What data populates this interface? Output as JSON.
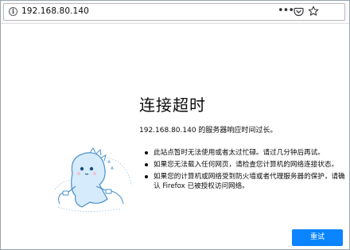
{
  "toolbar": {
    "url": "192.168.80.140",
    "icons": [
      "info-icon",
      "page-actions-menu-icon",
      "pocket-icon",
      "bookmark-star-icon"
    ],
    "menu_glyph": "•••"
  },
  "error_page": {
    "title": "连接超时",
    "description": "192.168.80.140 的服务器响应时间过长。",
    "suggestions": [
      "此站点暂时无法使用或者太过忙碌。请过几分钟后再试。",
      "如果您无法载入任何网页，请检查您计算机的网络连接状态。",
      "如果您的计算机或网络受到防火墙或者代理服务器的保护，请确认 Firefox 已被授权访问网络。"
    ],
    "retry_label": "重试"
  },
  "colors": {
    "accent": "#0a84ff",
    "illustration_fill": "#d6ebfb",
    "illustration_stroke": "#4a90c8"
  }
}
